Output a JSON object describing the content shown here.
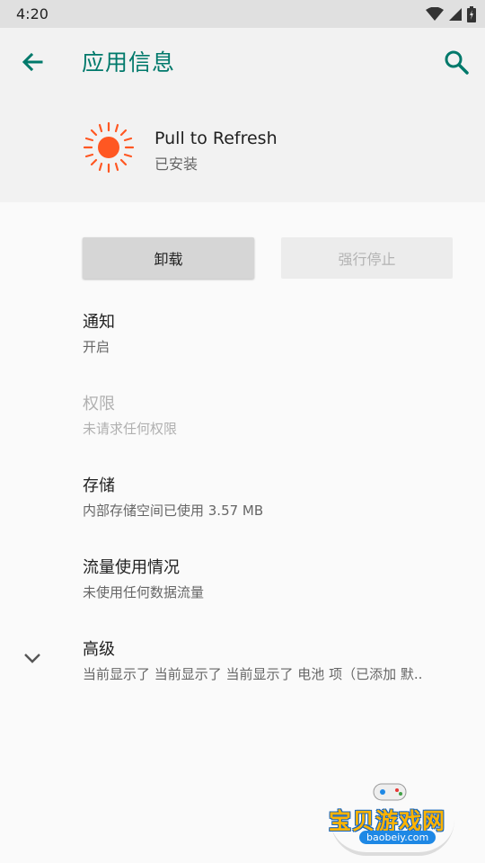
{
  "status_bar": {
    "time": "4:20"
  },
  "app_bar": {
    "title": "应用信息"
  },
  "header": {
    "app_name": "Pull to Refresh",
    "app_status": "已安装"
  },
  "buttons": {
    "uninstall": "卸载",
    "force_stop": "强行停止"
  },
  "items": [
    {
      "title": "通知",
      "subtitle": "开启"
    },
    {
      "title": "权限",
      "subtitle": "未请求任何权限"
    },
    {
      "title": "存储",
      "subtitle": "内部存储空间已使用 3.57 MB"
    },
    {
      "title": "流量使用情况",
      "subtitle": "未使用任何数据流量"
    },
    {
      "title": "高级",
      "subtitle": "当前显示了 当前显示了 当前显示了 电池 项（已添加 默.."
    }
  ],
  "watermark": {
    "name": "宝贝游戏网",
    "url": "baobeiy.com"
  },
  "colors": {
    "accent": "#00796b",
    "icon_sun": "#ff5722"
  }
}
